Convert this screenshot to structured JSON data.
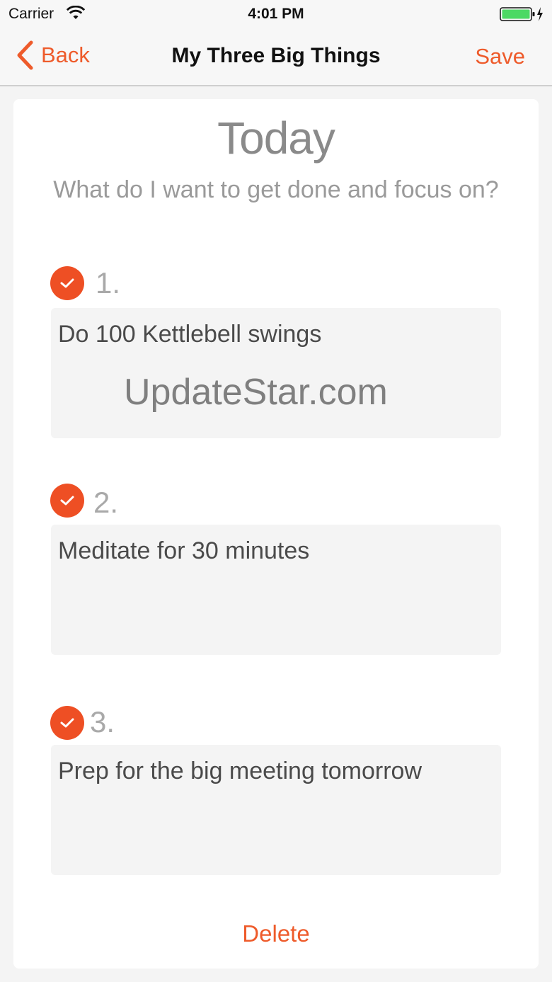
{
  "status_bar": {
    "carrier": "Carrier",
    "time": "4:01 PM"
  },
  "nav": {
    "back_label": "Back",
    "title": "My Three Big Things",
    "save_label": "Save"
  },
  "card": {
    "title": "Today",
    "subtitle": "What do I want to get done and focus on?",
    "tasks": [
      {
        "number": "1.",
        "text": "Do 100 Kettlebell swings",
        "checked": true
      },
      {
        "number": "2.",
        "text": "Meditate for 30 minutes",
        "checked": true
      },
      {
        "number": "3.",
        "text": "Prep for the big meeting tomorrow",
        "checked": true
      }
    ],
    "delete_label": "Delete"
  },
  "watermark": "UpdateStar.com",
  "colors": {
    "accent": "#ee5b2b",
    "check_fill": "#ee4f24",
    "battery": "#4cd964"
  },
  "icons": {
    "wifi": "wifi-icon",
    "battery": "battery-icon",
    "back": "chevron-left-icon",
    "check": "checkmark-icon"
  }
}
